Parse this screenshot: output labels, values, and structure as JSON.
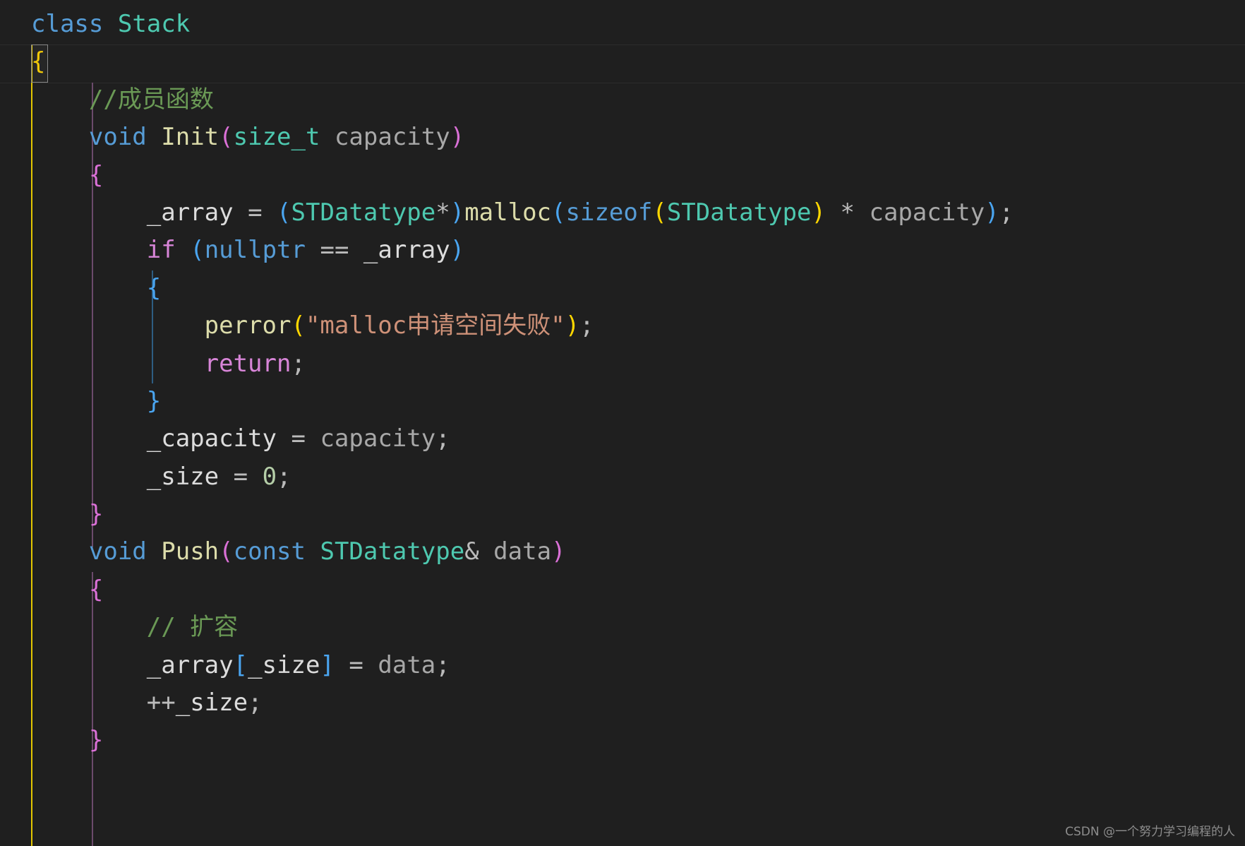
{
  "editor": {
    "language": "cpp",
    "theme": "dark-plus",
    "background_color": "#1f1f1f",
    "font_size_px": 34,
    "line_height_px": 53.4
  },
  "watermark": {
    "text": "CSDN @一个努力学习编程的人"
  },
  "code": {
    "lines": [
      {
        "n": 1,
        "indent": 0,
        "tokens": [
          {
            "t": "class",
            "c": "kw"
          },
          {
            "t": " ",
            "c": "op"
          },
          {
            "t": "Stack",
            "c": "cls"
          }
        ]
      },
      {
        "n": 2,
        "indent": 0,
        "tokens": [
          {
            "t": "{",
            "c": "b-yellow"
          }
        ]
      },
      {
        "n": 3,
        "indent": 1,
        "tokens": [
          {
            "t": "//成员函数",
            "c": "cmt"
          }
        ]
      },
      {
        "n": 4,
        "indent": 1,
        "tokens": [
          {
            "t": "void",
            "c": "kw"
          },
          {
            "t": " ",
            "c": "op"
          },
          {
            "t": "Init",
            "c": "fn"
          },
          {
            "t": "(",
            "c": "b-pink"
          },
          {
            "t": "size_t",
            "c": "type"
          },
          {
            "t": " ",
            "c": "op"
          },
          {
            "t": "capacity",
            "c": "var"
          },
          {
            "t": ")",
            "c": "b-pink"
          }
        ]
      },
      {
        "n": 5,
        "indent": 1,
        "tokens": [
          {
            "t": "{",
            "c": "b-pink"
          }
        ]
      },
      {
        "n": 6,
        "indent": 2,
        "tokens": [
          {
            "t": "_array",
            "c": "varw"
          },
          {
            "t": " ",
            "c": "op"
          },
          {
            "t": "=",
            "c": "op"
          },
          {
            "t": " ",
            "c": "op"
          },
          {
            "t": "(",
            "c": "b-blue"
          },
          {
            "t": "STDatatype",
            "c": "type"
          },
          {
            "t": "*",
            "c": "op"
          },
          {
            "t": ")",
            "c": "b-blue"
          },
          {
            "t": "malloc",
            "c": "fn"
          },
          {
            "t": "(",
            "c": "b-blue"
          },
          {
            "t": "sizeof",
            "c": "kw"
          },
          {
            "t": "(",
            "c": "b-gold"
          },
          {
            "t": "STDatatype",
            "c": "type"
          },
          {
            "t": ")",
            "c": "b-gold"
          },
          {
            "t": " ",
            "c": "op"
          },
          {
            "t": "*",
            "c": "op"
          },
          {
            "t": " ",
            "c": "op"
          },
          {
            "t": "capacity",
            "c": "var"
          },
          {
            "t": ")",
            "c": "b-blue"
          },
          {
            "t": ";",
            "c": "op"
          }
        ]
      },
      {
        "n": 7,
        "indent": 2,
        "tokens": [
          {
            "t": "if",
            "c": "kwc"
          },
          {
            "t": " ",
            "c": "op"
          },
          {
            "t": "(",
            "c": "b-blue"
          },
          {
            "t": "nullptr",
            "c": "kw"
          },
          {
            "t": " ",
            "c": "op"
          },
          {
            "t": "==",
            "c": "op"
          },
          {
            "t": " ",
            "c": "op"
          },
          {
            "t": "_array",
            "c": "varw"
          },
          {
            "t": ")",
            "c": "b-blue"
          }
        ]
      },
      {
        "n": 8,
        "indent": 2,
        "tokens": [
          {
            "t": "{",
            "c": "b-blue"
          }
        ]
      },
      {
        "n": 9,
        "indent": 3,
        "tokens": [
          {
            "t": "perror",
            "c": "fn"
          },
          {
            "t": "(",
            "c": "b-gold"
          },
          {
            "t": "\"malloc申请空间失败\"",
            "c": "str"
          },
          {
            "t": ")",
            "c": "b-gold"
          },
          {
            "t": ";",
            "c": "op"
          }
        ]
      },
      {
        "n": 10,
        "indent": 3,
        "tokens": [
          {
            "t": "return",
            "c": "kwc"
          },
          {
            "t": ";",
            "c": "op"
          }
        ]
      },
      {
        "n": 11,
        "indent": 2,
        "tokens": [
          {
            "t": "}",
            "c": "b-blue"
          }
        ]
      },
      {
        "n": 12,
        "indent": 2,
        "tokens": [
          {
            "t": "_capacity",
            "c": "varw"
          },
          {
            "t": " ",
            "c": "op"
          },
          {
            "t": "=",
            "c": "op"
          },
          {
            "t": " ",
            "c": "op"
          },
          {
            "t": "capacity",
            "c": "var"
          },
          {
            "t": ";",
            "c": "op"
          }
        ]
      },
      {
        "n": 13,
        "indent": 2,
        "tokens": [
          {
            "t": "_size",
            "c": "varw"
          },
          {
            "t": " ",
            "c": "op"
          },
          {
            "t": "=",
            "c": "op"
          },
          {
            "t": " ",
            "c": "op"
          },
          {
            "t": "0",
            "c": "num"
          },
          {
            "t": ";",
            "c": "op"
          }
        ]
      },
      {
        "n": 14,
        "indent": 1,
        "tokens": [
          {
            "t": "}",
            "c": "b-pink"
          }
        ]
      },
      {
        "n": 15,
        "indent": 1,
        "tokens": [
          {
            "t": "void",
            "c": "kw"
          },
          {
            "t": " ",
            "c": "op"
          },
          {
            "t": "Push",
            "c": "fn"
          },
          {
            "t": "(",
            "c": "b-pink"
          },
          {
            "t": "const",
            "c": "kw"
          },
          {
            "t": " ",
            "c": "op"
          },
          {
            "t": "STDatatype",
            "c": "type"
          },
          {
            "t": "&",
            "c": "op"
          },
          {
            "t": " ",
            "c": "op"
          },
          {
            "t": "data",
            "c": "var"
          },
          {
            "t": ")",
            "c": "b-pink"
          }
        ]
      },
      {
        "n": 16,
        "indent": 1,
        "tokens": [
          {
            "t": "{",
            "c": "b-pink"
          }
        ]
      },
      {
        "n": 17,
        "indent": 2,
        "tokens": [
          {
            "t": "// 扩容",
            "c": "cmt"
          }
        ]
      },
      {
        "n": 18,
        "indent": 2,
        "tokens": [
          {
            "t": "_array",
            "c": "varw"
          },
          {
            "t": "[",
            "c": "b-blue"
          },
          {
            "t": "_size",
            "c": "varw"
          },
          {
            "t": "]",
            "c": "b-blue"
          },
          {
            "t": " ",
            "c": "op"
          },
          {
            "t": "=",
            "c": "op"
          },
          {
            "t": " ",
            "c": "op"
          },
          {
            "t": "data",
            "c": "var"
          },
          {
            "t": ";",
            "c": "op"
          }
        ]
      },
      {
        "n": 19,
        "indent": 2,
        "tokens": [
          {
            "t": "++",
            "c": "op"
          },
          {
            "t": "_size",
            "c": "varw"
          },
          {
            "t": ";",
            "c": "op"
          }
        ]
      },
      {
        "n": 20,
        "indent": 1,
        "tokens": [
          {
            "t": "}",
            "c": "b-pink"
          }
        ]
      }
    ]
  }
}
